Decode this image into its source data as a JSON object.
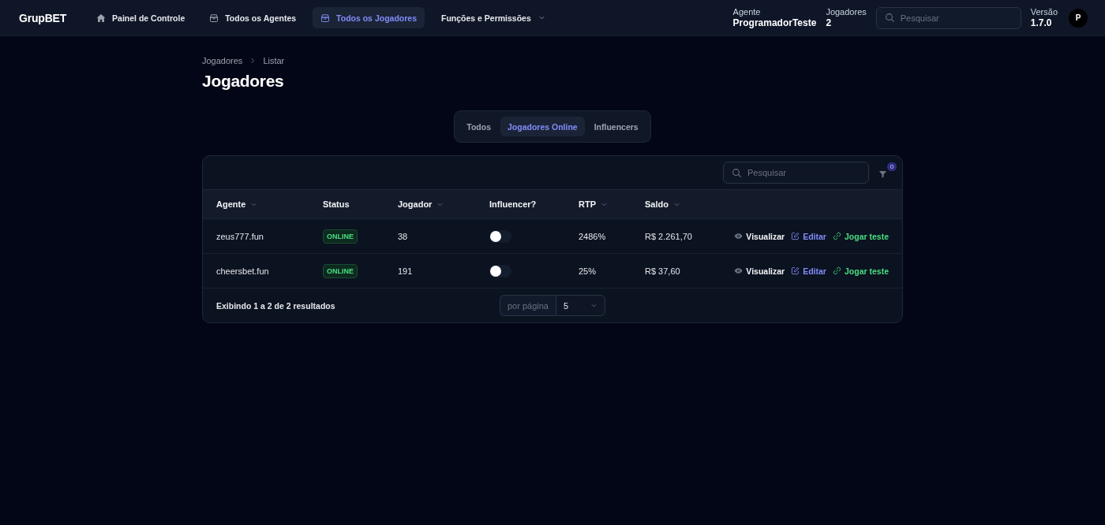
{
  "nav": {
    "logo": "GrupBET",
    "items": [
      {
        "label": "Painel de Controle",
        "kind": "page",
        "selected": false
      },
      {
        "label": "Todos os Agentes",
        "kind": "page",
        "selected": false
      },
      {
        "label": "Todos os Jogadores",
        "kind": "page",
        "selected": true
      },
      {
        "label": "Funções e Permissões",
        "kind": "menu",
        "selected": false
      }
    ]
  },
  "header": {
    "stats": [
      {
        "label": "Agente",
        "value": "ProgramadorTeste"
      },
      {
        "label": "Jogadores",
        "value": "2"
      }
    ],
    "search": {
      "placeholder": "Pesquisar"
    },
    "version": {
      "label": "Versão",
      "value": "1.7.0"
    },
    "avatar": "P"
  },
  "breadcrumb": [
    "Jogadores",
    "Listar"
  ],
  "title": "Jogadores",
  "tabs": [
    {
      "label": "Todos",
      "selected": false
    },
    {
      "label": "Jogadores Online",
      "selected": true
    },
    {
      "label": "Influencers",
      "selected": false
    }
  ],
  "table": {
    "search": {
      "placeholder": "Pesquisar"
    },
    "filter_count": "0",
    "columns": [
      {
        "label": "Agente",
        "sortable": true
      },
      {
        "label": "Status",
        "sortable": false
      },
      {
        "label": "Jogador",
        "sortable": true
      },
      {
        "label": "Influencer?",
        "sortable": false
      },
      {
        "label": "RTP",
        "sortable": true
      },
      {
        "label": "Saldo",
        "sortable": true
      }
    ],
    "rows": [
      {
        "agent": "zeus777.fun",
        "status": "ONLINE",
        "player": "38",
        "influencer": false,
        "rtp": "2486%",
        "balance": "R$ 2.261,70",
        "actions": [
          {
            "label": "Visualizar",
            "kind": "view"
          },
          {
            "label": "Editar",
            "kind": "edit"
          },
          {
            "label": "Jogar teste",
            "kind": "play"
          }
        ]
      },
      {
        "agent": "cheersbet.fun",
        "status": "ONLINE",
        "player": "191",
        "influencer": false,
        "rtp": "25%",
        "balance": "R$ 37,60",
        "actions": [
          {
            "label": "Visualizar",
            "kind": "view"
          },
          {
            "label": "Editar",
            "kind": "edit"
          },
          {
            "label": "Jogar teste",
            "kind": "play"
          }
        ]
      }
    ],
    "footer": {
      "summary": "Exibindo 1 a 2 de 2 resultados",
      "per_page": {
        "label": "por página",
        "value": "5"
      }
    }
  }
}
